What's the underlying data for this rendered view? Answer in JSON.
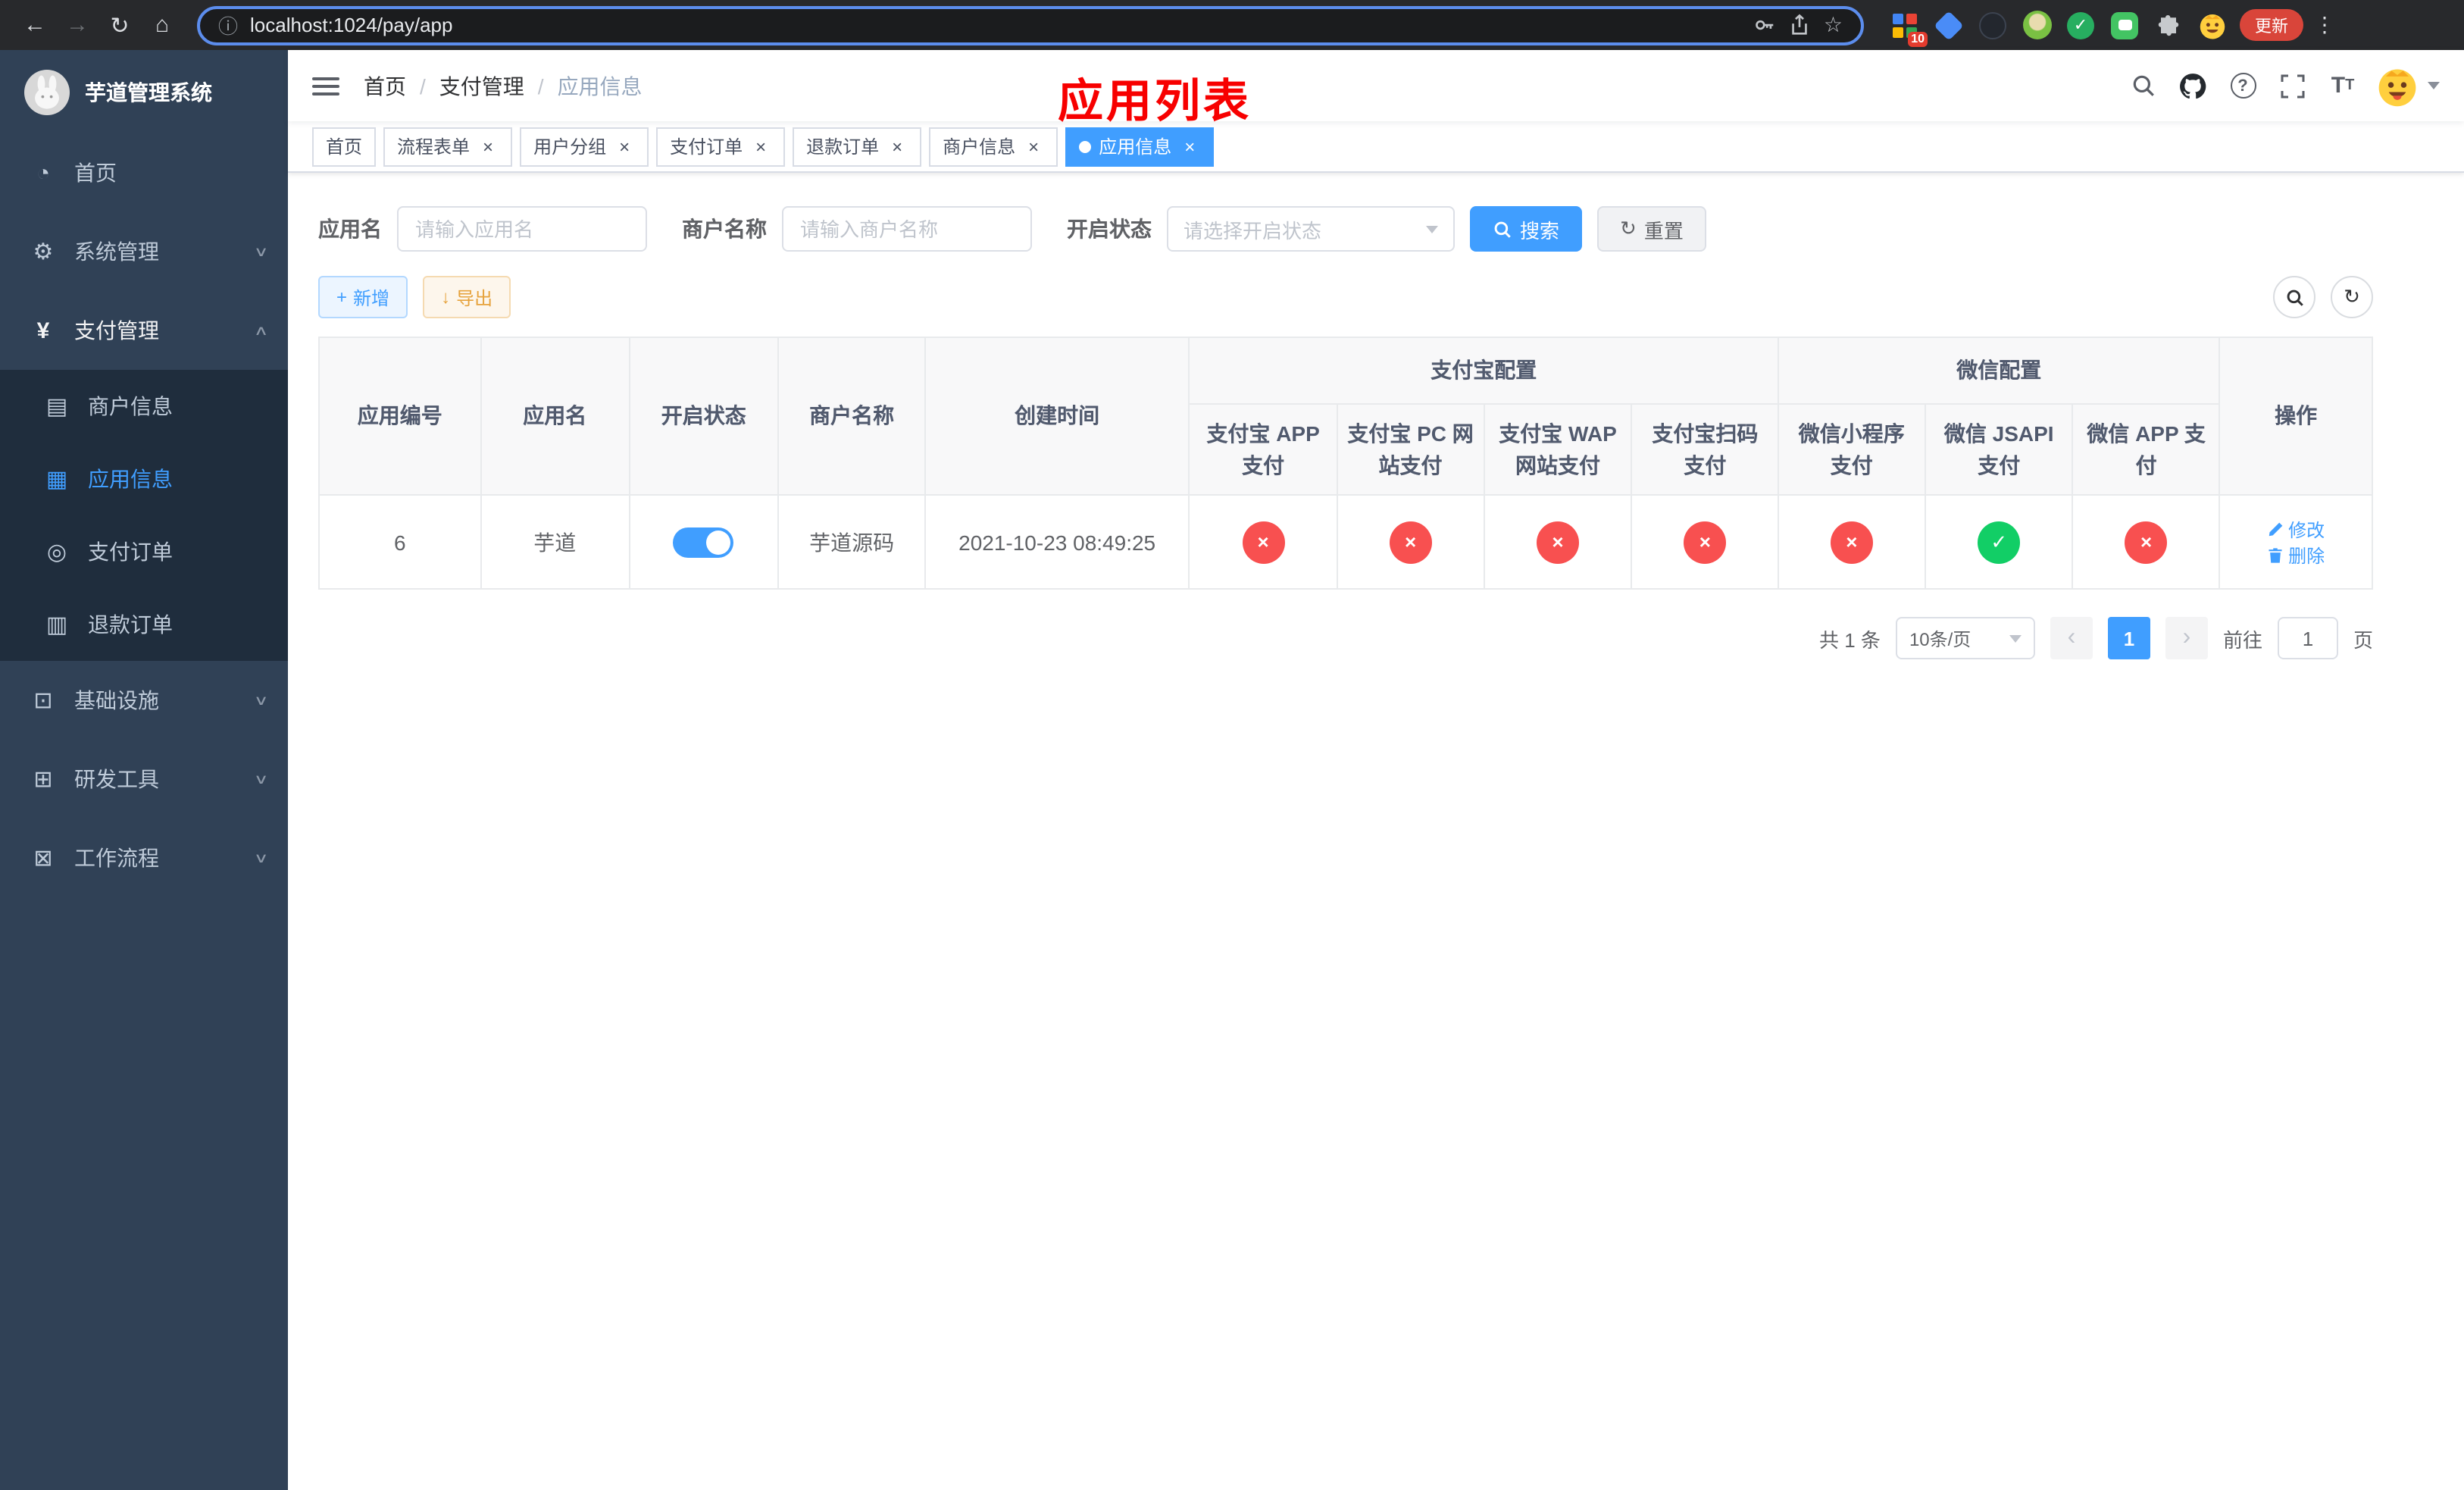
{
  "browser": {
    "url": "localhost:1024/pay/app",
    "update_label": "更新",
    "extension_badge": "10"
  },
  "sidebar": {
    "title": "芋道管理系统",
    "home": "首页",
    "system": "系统管理",
    "payment": "支付管理",
    "merchant_info": "商户信息",
    "app_info": "应用信息",
    "payment_order": "支付订单",
    "refund_order": "退款订单",
    "infrastructure": "基础设施",
    "dev_tools": "研发工具",
    "workflow": "工作流程"
  },
  "navbar": {
    "breadcrumb_home": "首页",
    "breadcrumb_section": "支付管理",
    "breadcrumb_current": "应用信息",
    "overlay_title": "应用列表"
  },
  "tabs": [
    {
      "label": "首页",
      "closable": false,
      "active": false
    },
    {
      "label": "流程表单",
      "closable": true,
      "active": false
    },
    {
      "label": "用户分组",
      "closable": true,
      "active": false
    },
    {
      "label": "支付订单",
      "closable": true,
      "active": false
    },
    {
      "label": "退款订单",
      "closable": true,
      "active": false
    },
    {
      "label": "商户信息",
      "closable": true,
      "active": false
    },
    {
      "label": "应用信息",
      "closable": true,
      "active": true
    }
  ],
  "filters": {
    "app_name_label": "应用名",
    "app_name_placeholder": "请输入应用名",
    "merchant_label": "商户名称",
    "merchant_placeholder": "请输入商户名称",
    "status_label": "开启状态",
    "status_placeholder": "请选择开启状态",
    "search_label": "搜索",
    "reset_label": "重置"
  },
  "toolbar": {
    "add_label": "新增",
    "export_label": "导出"
  },
  "table": {
    "headers": {
      "app_id": "应用编号",
      "app_name": "应用名",
      "status": "开启状态",
      "merchant": "商户名称",
      "created": "创建时间",
      "alipay_group": "支付宝配置",
      "wechat_group": "微信配置",
      "alipay_app": "支付宝 APP 支付",
      "alipay_pc": "支付宝 PC 网站支付",
      "alipay_wap": "支付宝 WAP 网站支付",
      "alipay_scan": "支付宝扫码支付",
      "wx_lite": "微信小程序支付",
      "wx_jsapi": "微信 JSAPI 支付",
      "wx_app": "微信 APP 支付",
      "ops": "操作"
    },
    "rows": [
      {
        "id": "6",
        "name": "芋道",
        "enabled": true,
        "merchant": "芋道源码",
        "created": "2021-10-23 08:49:25",
        "alipay_app": false,
        "alipay_pc": false,
        "alipay_wap": false,
        "alipay_scan": false,
        "wx_lite": false,
        "wx_jsapi": true,
        "wx_app": false,
        "edit_label": "修改",
        "delete_label": "删除"
      }
    ]
  },
  "pagination": {
    "total": "共 1 条",
    "page_size": "10条/页",
    "page": "1",
    "goto_label": "前往",
    "goto_value": "1",
    "goto_unit": "页"
  },
  "colors": {
    "primary": "#409eff",
    "success": "#12ce66",
    "danger": "#f85050",
    "warning": "#e6a23c",
    "sidebar_bg": "#304156",
    "submenu_bg": "#1f2d3d",
    "annotation_red": "#f70000"
  }
}
